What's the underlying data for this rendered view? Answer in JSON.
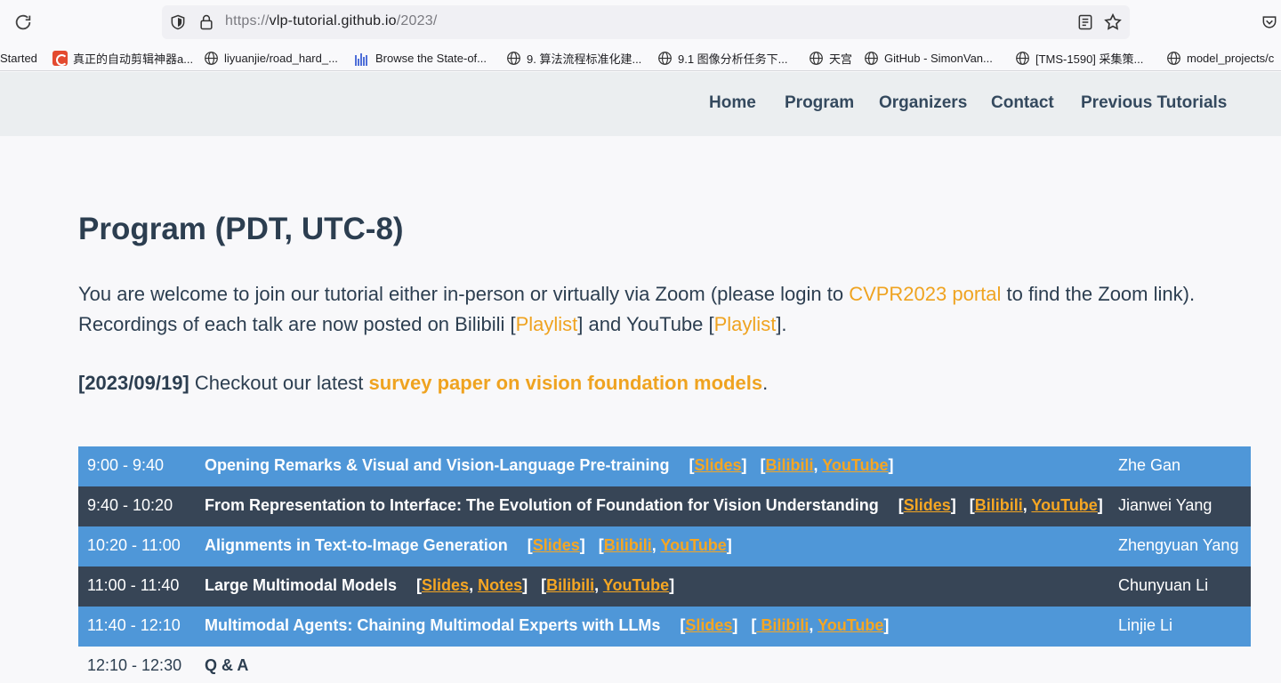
{
  "browser": {
    "url_prefix": "https://",
    "url_host": "vlp-tutorial.github.io",
    "url_path": "/2023/",
    "bookmarks": [
      {
        "label": "Started",
        "icon": "none"
      },
      {
        "label": "真正的自动剪辑神器a...",
        "icon": "app-red-icon"
      },
      {
        "label": "liyuanjie/road_hard_...",
        "icon": "globe-icon"
      },
      {
        "label": "Browse the State-of...",
        "icon": "bars-icon"
      },
      {
        "label": "9. 算法流程标准化建...",
        "icon": "globe-icon"
      },
      {
        "label": "9.1 图像分析任务下...",
        "icon": "globe-icon"
      },
      {
        "label": "天宫",
        "icon": "globe-icon"
      },
      {
        "label": "GitHub - SimonVan...",
        "icon": "globe-icon"
      },
      {
        "label": "[TMS-1590] 采集策...",
        "icon": "globe-icon"
      },
      {
        "label": "model_projects/c",
        "icon": "globe-icon"
      }
    ]
  },
  "nav": {
    "items": [
      "Home",
      "Program",
      "Organizers",
      "Contact",
      "Previous Tutorials"
    ]
  },
  "main": {
    "title": "Program (PDT, UTC-8)",
    "intro_1": "You are welcome to join our tutorial either in-person or virtually via Zoom (please login to ",
    "intro_link": "CVPR2023 portal",
    "intro_2": " to find the Zoom link). Recordings of each talk are now posted on Bilibili [",
    "intro_playlist1": "Playlist",
    "intro_3": "] and YouTube [",
    "intro_playlist2": "Playlist",
    "intro_4": "].",
    "news_date": "[2023/09/19]",
    "news_text": " Checkout our latest ",
    "news_link": "survey paper on vision foundation models",
    "news_end": "."
  },
  "program": [
    {
      "time": "9:00 - 9:40",
      "title": "Opening Remarks & Visual and Vision-Language Pre-training",
      "links": [
        [
          "Slides"
        ],
        [
          "Bilibili",
          "YouTube"
        ]
      ],
      "speaker": "Zhe Gan",
      "style": "blue"
    },
    {
      "time": "9:40 - 10:20",
      "title": "From Representation to Interface: The Evolution of Foundation for Vision Understanding",
      "links": [
        [
          "Slides"
        ],
        [
          "Bilibili",
          "YouTube"
        ]
      ],
      "speaker": "Jianwei Yang",
      "style": "dark"
    },
    {
      "time": "10:20 - 11:00",
      "title": "Alignments in Text-to-Image Generation",
      "links": [
        [
          "Slides"
        ],
        [
          "Bilibili",
          "YouTube"
        ]
      ],
      "speaker": "Zhengyuan Yang",
      "style": "blue"
    },
    {
      "time": "11:00 - 11:40",
      "title": "Large Multimodal Models",
      "links": [
        [
          "Slides",
          "Notes"
        ],
        [
          "Bilibili",
          "YouTube"
        ]
      ],
      "speaker": "Chunyuan Li",
      "style": "dark"
    },
    {
      "time": "11:40 - 12:10",
      "title": "Multimodal Agents: Chaining Multimodal Experts with LLMs",
      "links": [
        [
          "Slides"
        ],
        [
          " Bilibili",
          "YouTube"
        ]
      ],
      "speaker": "Linjie Li",
      "style": "blue"
    },
    {
      "time": "12:10 - 12:30",
      "title": "Q & A",
      "links": [],
      "speaker": "",
      "style": "plain"
    }
  ],
  "colors": {
    "accent": "#efa320",
    "row_blue": "#4f97d8",
    "row_dark": "#374556",
    "text": "#2c3e50"
  }
}
